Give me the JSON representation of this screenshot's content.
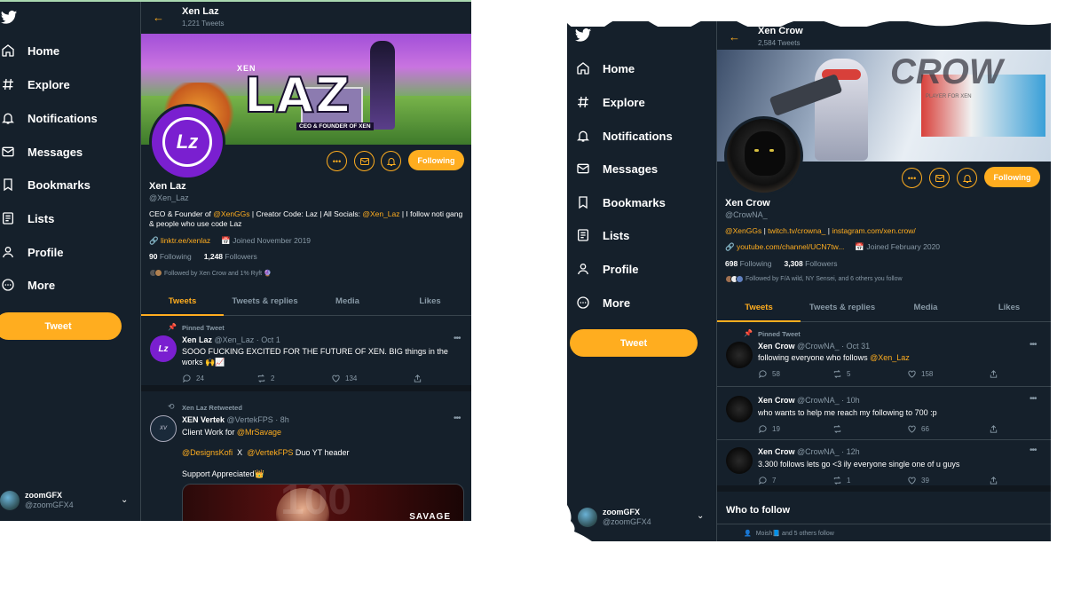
{
  "left": {
    "nav": [
      {
        "label": "Home",
        "icon": "home-icon"
      },
      {
        "label": "Explore",
        "icon": "hashtag-icon"
      },
      {
        "label": "Notifications",
        "icon": "bell-icon"
      },
      {
        "label": "Messages",
        "icon": "mail-icon"
      },
      {
        "label": "Bookmarks",
        "icon": "bookmark-icon"
      },
      {
        "label": "Lists",
        "icon": "list-icon"
      },
      {
        "label": "Profile",
        "icon": "person-icon"
      },
      {
        "label": "More",
        "icon": "more-circle-icon"
      }
    ],
    "tweet_button": "Tweet",
    "account": {
      "name": "zoomGFX",
      "handle": "@zoomGFX4"
    },
    "header": {
      "title": "Xen Laz",
      "subtitle": "1,221 Tweets"
    },
    "banner": {
      "small": "XEN",
      "big": "LAZ",
      "tagline": "CEO & FOUNDER OF XEN"
    },
    "following_label": "Following",
    "profile": {
      "name": "Xen Laz",
      "handle": "@Xen_Laz",
      "bio_1": "CEO & Founder of ",
      "bio_link_1": "@XenGGs",
      "bio_2": " | Creator Code: Laz | All Socials: ",
      "bio_link_2": "@Xen_Laz",
      "bio_3": " | I follow noti gang & people who use code Laz",
      "link": "linktr.ee/xenlaz",
      "joined": "Joined November 2019",
      "following_count": "90",
      "following_label": "Following",
      "followers_count": "1,248",
      "followers_label": "Followers",
      "followed_by": "Followed by Xen Crow and 1% Ryft 🔮"
    },
    "tabs": [
      "Tweets",
      "Tweets & replies",
      "Media",
      "Likes"
    ],
    "tweets": [
      {
        "context": "Pinned Tweet",
        "name": "Xen Laz",
        "meta": "@Xen_Laz · Oct 1",
        "text": "SOOO FUCKING EXCITED FOR THE FUTURE OF XEN. BIG things in the works 🙌📈",
        "replies": "24",
        "retweets": "2",
        "likes": "134"
      },
      {
        "context": "Xen Laz Retweeted",
        "name": "XEN Vertek",
        "meta": "@VertekFPS · 8h",
        "text_1": "Client Work for ",
        "text_link": "@MrSavage",
        "line2_link_a": "@DesignsKofi",
        "line2_mid": "  X  ",
        "line2_link_b": "@VertekFPS",
        "line2_end": " Duo YT header",
        "line3": "Support Appreciated👑",
        "media_text": "SAVAGE"
      }
    ]
  },
  "right": {
    "nav": [
      {
        "label": "Home",
        "icon": "home-icon"
      },
      {
        "label": "Explore",
        "icon": "hashtag-icon"
      },
      {
        "label": "Notifications",
        "icon": "bell-icon"
      },
      {
        "label": "Messages",
        "icon": "mail-icon"
      },
      {
        "label": "Bookmarks",
        "icon": "bookmark-icon"
      },
      {
        "label": "Lists",
        "icon": "list-icon"
      },
      {
        "label": "Profile",
        "icon": "person-icon"
      },
      {
        "label": "More",
        "icon": "more-circle-icon"
      }
    ],
    "tweet_button": "Tweet",
    "account": {
      "name": "zoomGFX",
      "handle": "@zoomGFX4"
    },
    "header": {
      "title": "Xen Crow",
      "subtitle": "2,584 Tweets"
    },
    "banner": {
      "big": "CROW",
      "tagline": "PLAYER FOR XEN"
    },
    "following_label": "Following",
    "profile": {
      "name": "Xen Crow",
      "handle": "@CrowNA_",
      "bio_link_1": "@XenGGs",
      "bio_sep_1": " | ",
      "bio_link_2": "twitch.tv/crowna_",
      "bio_sep_2": " | ",
      "bio_link_3": "instagram.com/xen.crow/",
      "link": "youtube.com/channel/UCN7tw...",
      "joined": "Joined February 2020",
      "following_count": "698",
      "following_label": "Following",
      "followers_count": "3,308",
      "followers_label": "Followers",
      "followed_by": "Followed by F/A wild, NY Sensei, and 6 others you follow"
    },
    "tabs": [
      "Tweets",
      "Tweets & replies",
      "Media",
      "Likes"
    ],
    "tweets": [
      {
        "context": "Pinned Tweet",
        "name": "Xen Crow",
        "meta": "@CrowNA_ · Oct 31",
        "text_1": "following everyone who follows ",
        "text_link": "@Xen_Laz",
        "replies": "58",
        "retweets": "5",
        "likes": "158"
      },
      {
        "name": "Xen Crow",
        "meta": "@CrowNA_ · 10h",
        "text": "who wants to help me reach my following to 700 :p",
        "replies": "19",
        "retweets": "",
        "likes": "66"
      },
      {
        "name": "Xen Crow",
        "meta": "@CrowNA_ · 12h",
        "text": "3.300 follows lets go <3 ily everyone single one of u guys",
        "replies": "7",
        "retweets": "1",
        "likes": "39"
      }
    ],
    "who_to_follow": "Who to follow",
    "who_followed_by": "Moish📘 and 5 others follow"
  },
  "colors": {
    "accent": "#ffad1f",
    "background": "#15202b",
    "muted": "#8899a6",
    "border": "#38444d"
  }
}
